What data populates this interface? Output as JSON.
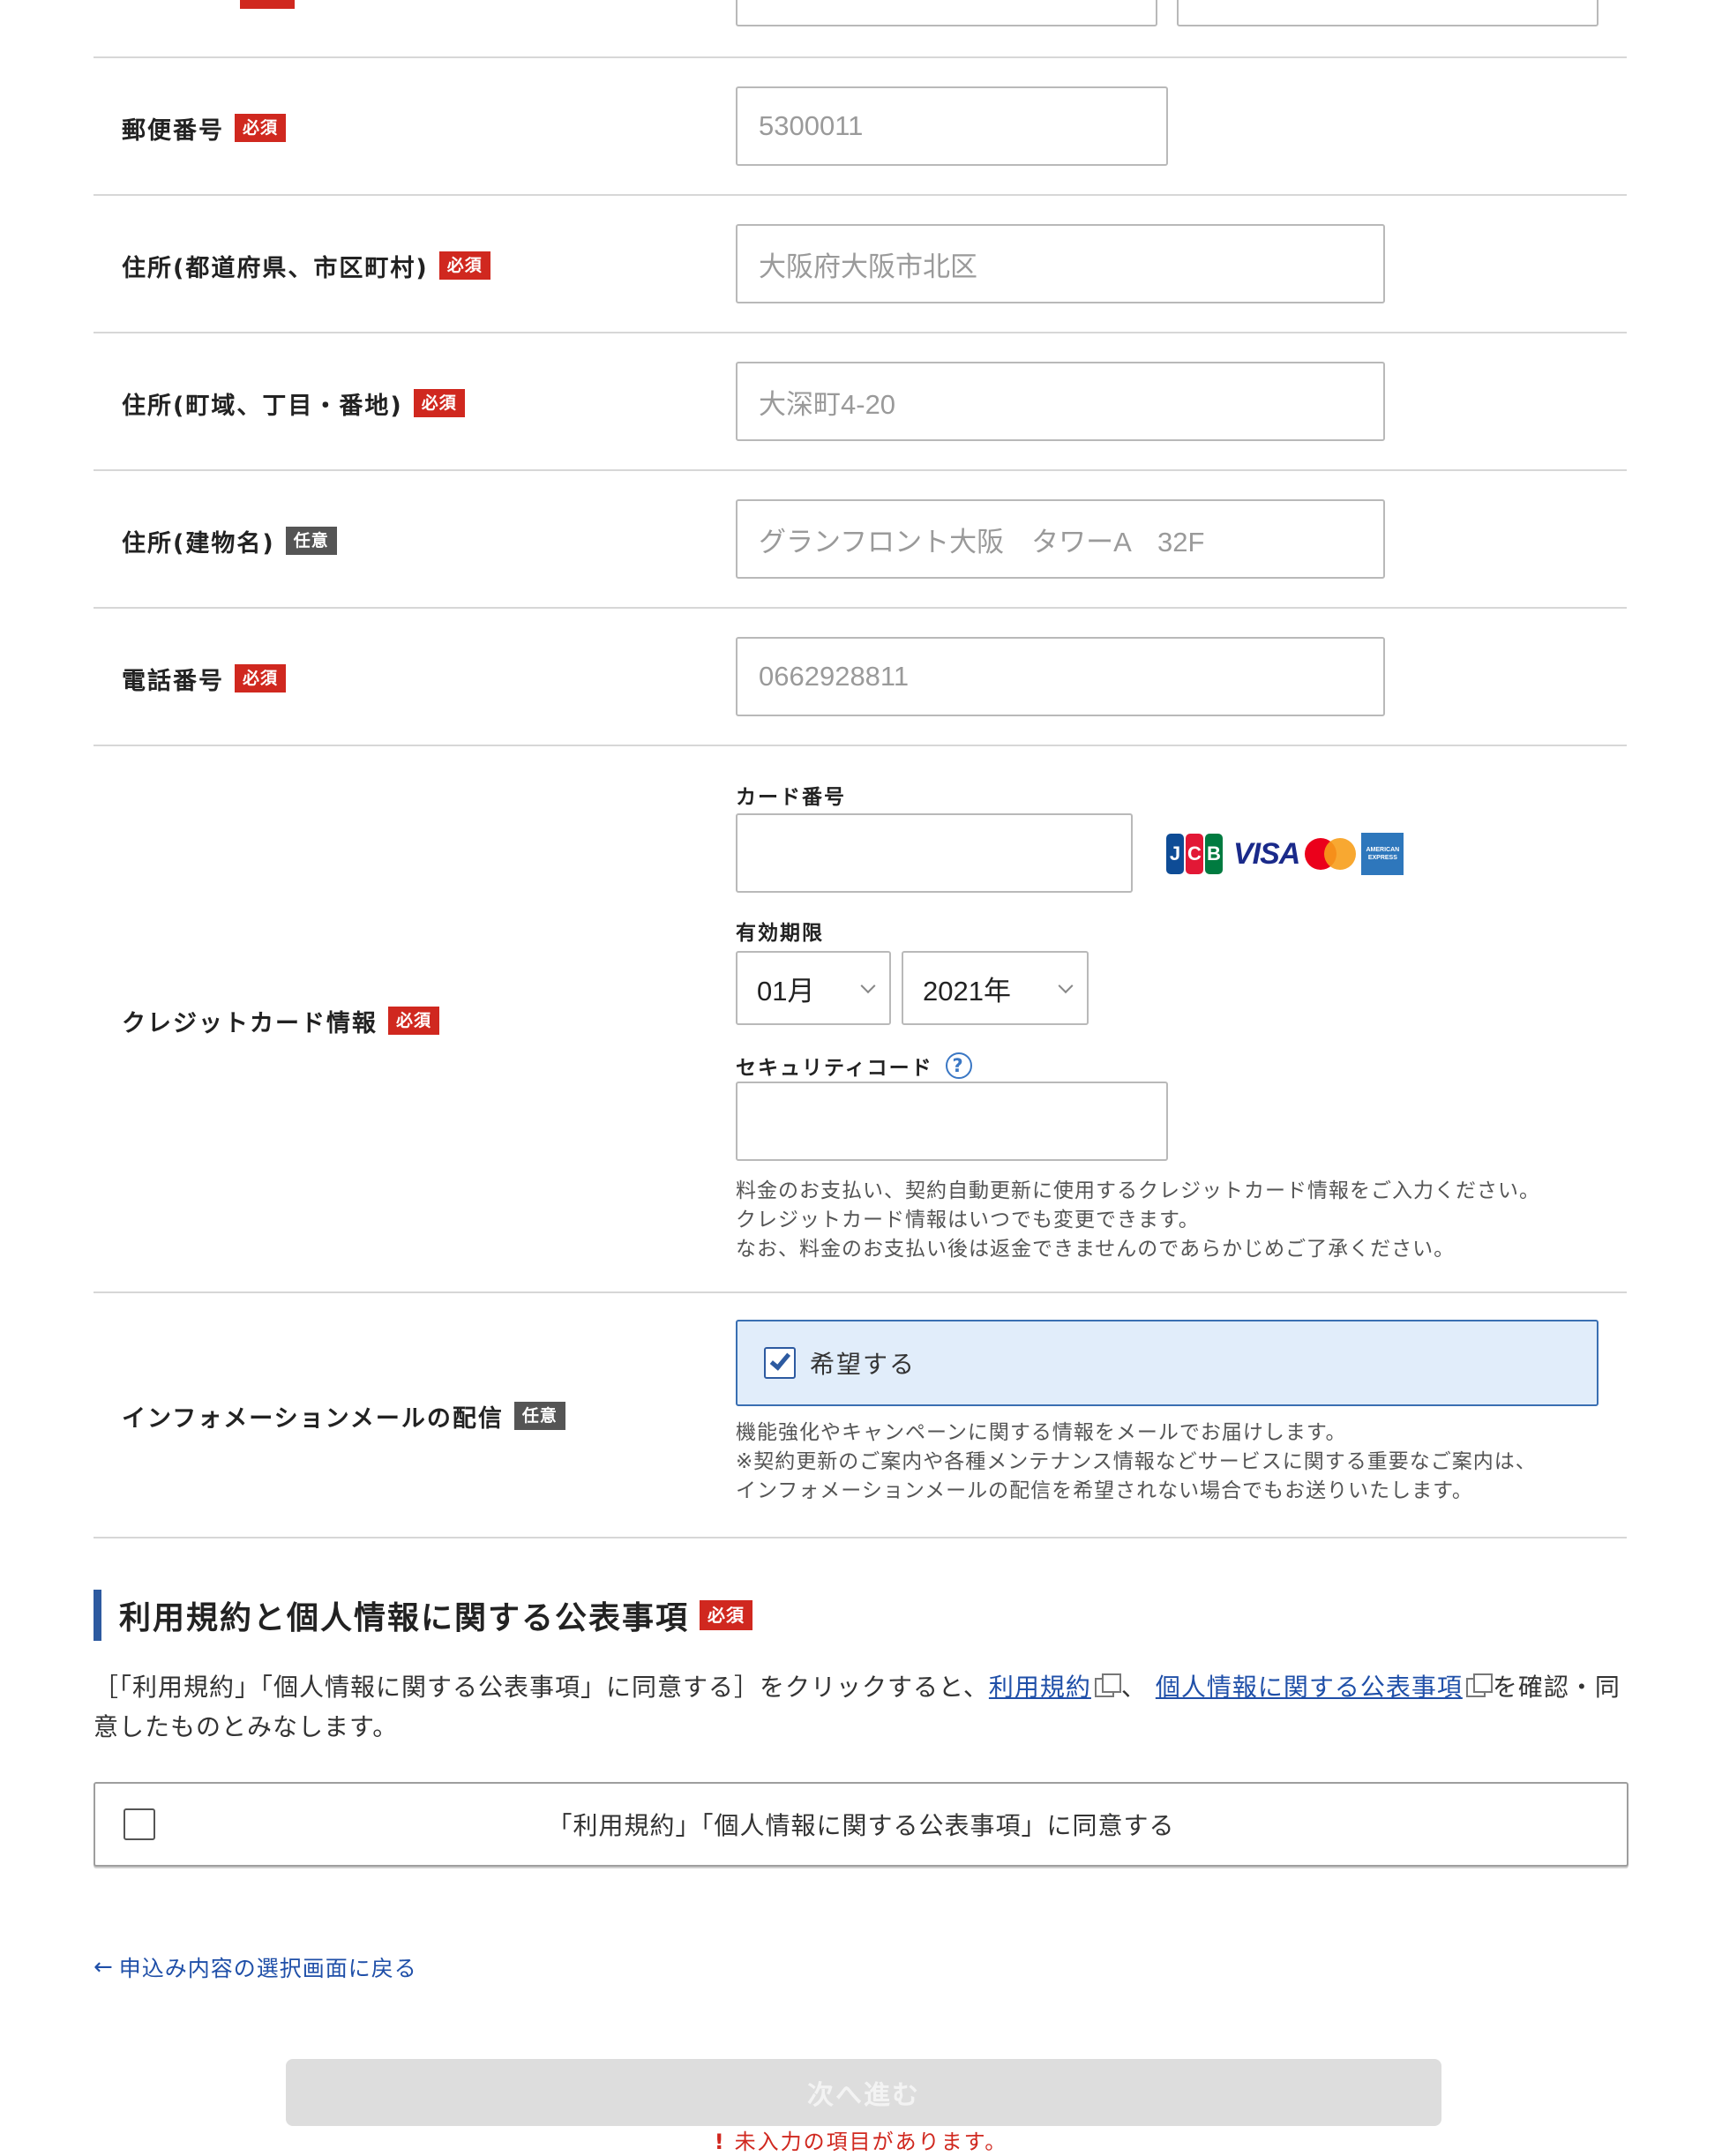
{
  "form": {
    "postal_code": {
      "label": "郵便番号",
      "badge": "必須",
      "placeholder": "5300011"
    },
    "address_city": {
      "label": "住所(都道府県、市区町村)",
      "badge": "必須",
      "placeholder": "大阪府大阪市北区"
    },
    "address_town": {
      "label": "住所(町域、丁目・番地)",
      "badge": "必須",
      "placeholder": "大深町4-20"
    },
    "address_building": {
      "label": "住所(建物名)",
      "badge": "任意",
      "placeholder": "グランフロント大阪　タワーA　32F"
    },
    "phone": {
      "label": "電話番号",
      "badge": "必須",
      "placeholder": "0662928811"
    },
    "credit_card": {
      "label": "クレジットカード情報",
      "badge": "必須",
      "card_number_label": "カード番号",
      "brands": {
        "jcb": [
          "J",
          "C",
          "B"
        ],
        "visa": "VISA",
        "amex_top": "AMERICAN",
        "amex_bottom": "EXPRESS"
      },
      "expiry_label": "有効期限",
      "expiry_month": "01月",
      "expiry_year": "2021年",
      "security_code_label": "セキュリティコード",
      "help": "?",
      "notes": [
        "料金のお支払い、契約自動更新に使用するクレジットカード情報をご入力ください。",
        "クレジットカード情報はいつでも変更できます。",
        "なお、料金のお支払い後は返金できませんのであらかじめご了承ください。"
      ]
    },
    "info_mail": {
      "label": "インフォメーションメールの配信",
      "badge": "任意",
      "checkbox_label": "希望する",
      "checked": true,
      "notes": [
        "機能強化やキャンペーンに関する情報をメールでお届けします。",
        "※契約更新のご案内や各種メンテナンス情報などサービスに関する重要なご案内は、",
        "インフォメーションメールの配信を希望されない場合でもお送りいたします。"
      ]
    }
  },
  "terms": {
    "title": "利用規約と個人情報に関する公表事項",
    "badge": "必須",
    "text_before": "［「利用規約」「個人情報に関する公表事項」に同意する］をクリックすると、",
    "link_terms": "利用規約",
    "separator": "、",
    "link_privacy": "個人情報に関する公表事項",
    "text_after": "を確認・同意したものとみなします。",
    "agree_label": "「利用規約」「個人情報に関する公表事項」に同意する",
    "agree_checked": false
  },
  "nav": {
    "back_arrow": "←",
    "back_label": "申込み内容の選択画面に戻る",
    "next_label": "次へ進む",
    "error_icon": "!",
    "error_text": "未入力の項目があります。"
  },
  "colors": {
    "required_badge": "#d0281f",
    "optional_badge": "#555555",
    "accent": "#2d5aa0",
    "optin_bg": "#e1edfa",
    "link": "#1f4fa8",
    "disabled_button": "#dddddd"
  }
}
